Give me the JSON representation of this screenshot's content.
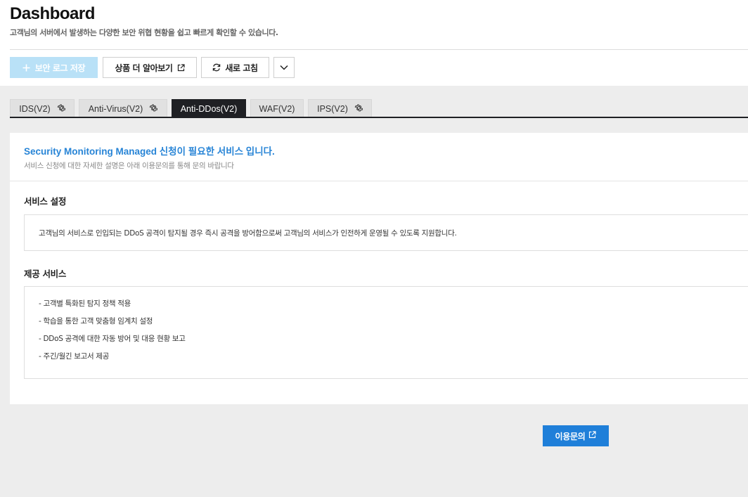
{
  "header": {
    "title": "Dashboard",
    "subtitle": "고객님의 서버에서 발생하는 다양한 보안 위협 현황을 쉽고 빠르게 확인할 수 있습니다."
  },
  "toolbar": {
    "save_label": "보안 로그 저장",
    "more_label": "상품 더 알아보기",
    "refresh_label": "새로 고침"
  },
  "tabs": [
    {
      "label": "IDS(V2)",
      "has_gear": true
    },
    {
      "label": "Anti-Virus(V2)",
      "has_gear": true
    },
    {
      "label": "Anti-DDos(V2)",
      "has_gear": false,
      "active": true
    },
    {
      "label": "WAF(V2)",
      "has_gear": false
    },
    {
      "label": "IPS(V2)",
      "has_gear": true
    }
  ],
  "notice": {
    "title": "Security Monitoring Managed 신청이 필요한 서비스 입니다.",
    "description": "서비스 신청에 대한 자세한 설명은 아래 이용문의를 통해 문의 바랍니다"
  },
  "service_settings": {
    "heading": "서비스 설정",
    "text": "고객님의 서비스로 인입되는 DDoS 공격이 탐지될 경우 즉시 공격을 방어함으로써 고객님의 서비스가 인전하게 운영될 수 있도록 지원합니다."
  },
  "provided_services": {
    "heading": "제공 서비스",
    "items": [
      "- 고객별 특화된 탐지 정책 적용",
      "- 학습을 통한 고객 맞춤형 임계치 설정",
      "- DDoS 공격에 대한 자동 방어 및 대응 현황 보고",
      "- 주긴/월긴 보고서 제공"
    ]
  },
  "cta": {
    "label": "이용문의"
  },
  "colors": {
    "accent": "#1f7fd9",
    "notice_title": "#2784d6",
    "tab_active": "#1f2024",
    "save_disabled": "#b9e1f7"
  }
}
